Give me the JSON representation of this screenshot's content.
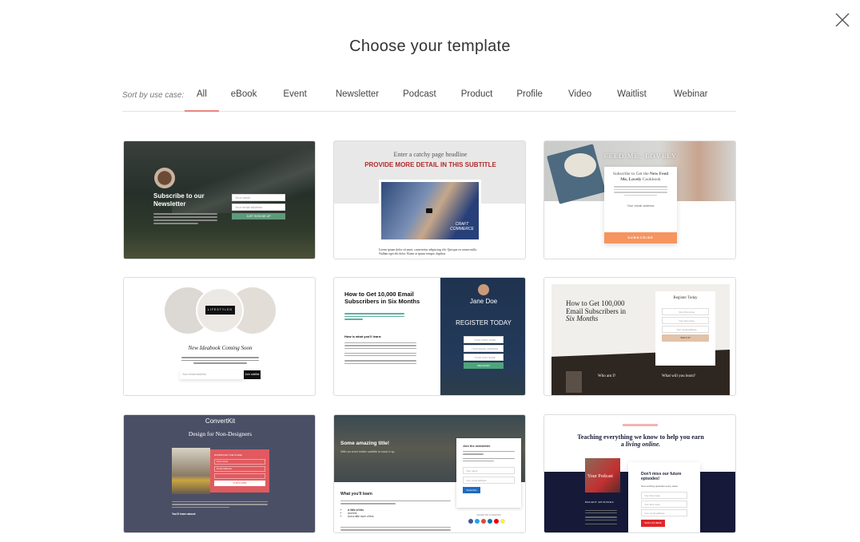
{
  "modal": {
    "title": "Choose your template",
    "close_icon": "close-icon"
  },
  "filters": {
    "label": "Sort by use case:",
    "active": "All",
    "tabs": [
      "All",
      "eBook",
      "Event",
      "Newsletter",
      "Podcast",
      "Product",
      "Profile",
      "Video",
      "Waitlist",
      "Webinar"
    ],
    "accent": "#e8867e"
  },
  "templates": [
    {
      "headline": "Subscribe to our Newsletter",
      "fields": [
        "Your name",
        "Your email address"
      ],
      "button": "JUST SIGN ME UP"
    },
    {
      "headline": "Enter a catchy page headline",
      "subtitle": "PROVIDE MORE DETAIL IN THIS SUBTITLE",
      "video_brand": "CRAFT COMMERCE",
      "body": "Lorem ipsum dolor sit amet, consectetur adipiscing elit. Quisque eu ornare nulla. Nullam eget elit dolor. Etiam at ipsum tempor, dapibus"
    },
    {
      "brand": "FEED ME, LOVELY",
      "headline_a": "Subscribe to Get the ",
      "headline_b": "New Feed Me, Lovely",
      "headline_c": " Cookbook",
      "field": "Your email address",
      "button": "SUBSCRIBE",
      "accent": "#f5955f"
    },
    {
      "badge": "LIFESTYLED",
      "headline": "New Ideabook Coming Soon",
      "field": "Your email address",
      "button": "Join waitlist"
    },
    {
      "headline": "How to Get 10,000 Email Subscribers in Six Months",
      "section": "How is what you'll learn:",
      "host": "Jane Doe",
      "register": "REGISTER TODAY",
      "fields": [
        "YOUR FIRST NAME",
        "YOUR EMAIL ADDRESS",
        "YOUR LAST NAME"
      ],
      "button": "REGISTER"
    },
    {
      "headline_a": "How to Get 100,000 Email Subscribers in",
      "headline_b": "Six Months",
      "form_title": "Register Today",
      "fields": [
        "Your first name",
        "Your last name",
        "Your email address"
      ],
      "button": "SIGN UP",
      "who": "Who am I?",
      "learn": "What will you learn?"
    },
    {
      "brand": "ConvertKit",
      "headline": "Design for Non-Designers",
      "form_label": "DOWNLOAD THE GUIDE",
      "fields": [
        "First name",
        "Email address"
      ],
      "button": "SUBSCRIBE",
      "learn": "You'll learn about:",
      "accent": "#e05a5f"
    },
    {
      "headline": "Some amazing title!",
      "subtitle": "With an even better subtitle to back it up",
      "form_title": "Join the newsletter",
      "fields": [
        "Your name",
        "Your email address"
      ],
      "button": "Subscribe",
      "section": "What you'll learn",
      "list": [
        "A little of this",
        "And this",
        "And a little more of this"
      ],
      "share": "SHARE WITH FRIENDS"
    },
    {
      "headline_a": "Teaching everything we know to help you earn a ",
      "headline_b": "living online.",
      "cover": "Your Podcast",
      "form_title": "Don't miss our future episodes!",
      "form_sub": "New exciting episodes every week.",
      "fields": [
        "Your first name",
        "Your last name",
        "Your email address"
      ],
      "button": "SIGN UP HERE",
      "recent": "RECENT EPISODES",
      "accent": "#e0262b"
    }
  ]
}
